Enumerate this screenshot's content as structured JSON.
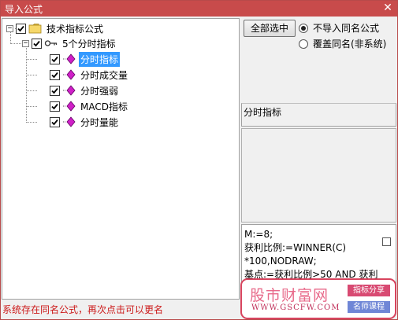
{
  "window": {
    "title": "导入公式",
    "close_glyph": "✕"
  },
  "tree": {
    "root": {
      "label": "技术指标公式",
      "expander": "−",
      "checked": true,
      "icon": "folder-icon"
    },
    "group": {
      "label": "5个分时指标",
      "expander": "−",
      "checked": true,
      "icon": "key-icon"
    },
    "items": [
      {
        "label": "分时指标",
        "checked": true,
        "selected": true,
        "icon": "formula-diamond-icon"
      },
      {
        "label": "分时成交量",
        "checked": true,
        "selected": false,
        "icon": "formula-diamond-icon"
      },
      {
        "label": "分时强弱",
        "checked": true,
        "selected": false,
        "icon": "formula-diamond-icon"
      },
      {
        "label": "MACD指标",
        "checked": true,
        "selected": false,
        "icon": "formula-diamond-icon"
      },
      {
        "label": "分时量能",
        "checked": true,
        "selected": false,
        "icon": "formula-diamond-icon"
      }
    ]
  },
  "options": {
    "select_all_label": "全部选中",
    "radio_no_import": {
      "label": "不导入同名公式",
      "selected": true
    },
    "radio_overwrite": {
      "label": "覆盖同名(非系统)",
      "selected": false
    }
  },
  "details": {
    "formula_name": "分时指标",
    "description": "",
    "formula_lines": [
      "M:=8;",
      "获利比例:=WINNER(C)",
      "*100,NODRAW;",
      "基点:=获利比例>50 AND 获利"
    ]
  },
  "watermark": {
    "name": "股市财富网",
    "url": "WWW.GSCFW.COM",
    "tag1": "指标分享",
    "tag2": "名师课程"
  },
  "status_text": "系统存在同名公式，再次点击可以更名",
  "colors": {
    "titlebar": "#c84b4b",
    "selection": "#3399ff",
    "status": "#cc1a1a",
    "diamond": "#d020c8"
  }
}
